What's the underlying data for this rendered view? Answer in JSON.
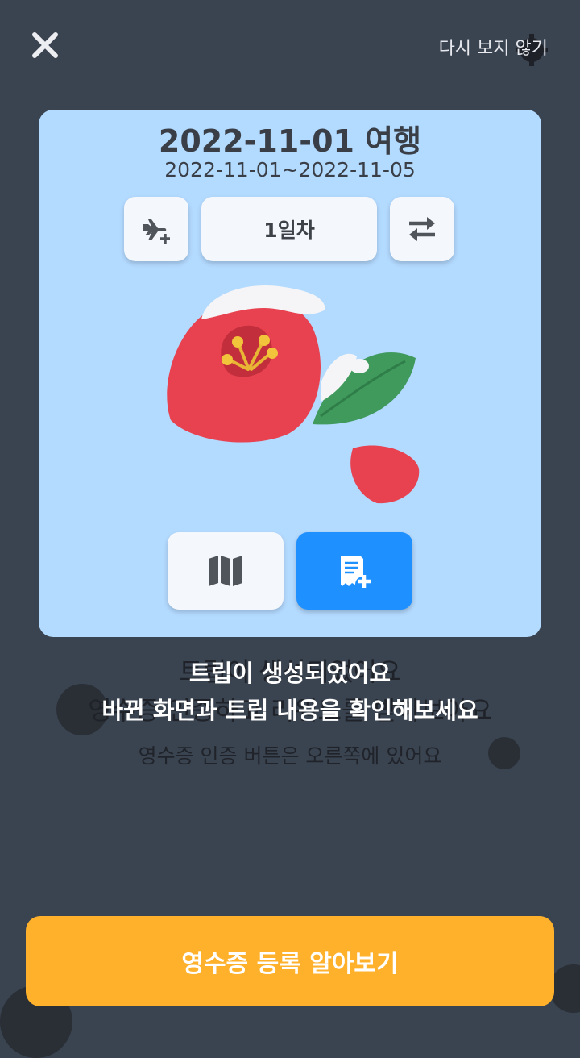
{
  "header": {
    "close_icon": "close-icon",
    "dont_show_again": "다시 보지 않기"
  },
  "trip_card": {
    "title": "2022-11-01 여행",
    "dates": "2022-11-01~2022-11-05",
    "add_flight_icon": "flight-add-icon",
    "day_label": "1일차",
    "swap_icon": "swap-icon",
    "illustration": "camellia-flower-icon",
    "map_icon": "map-icon",
    "receipt_add_icon": "receipt-add-icon"
  },
  "messages": {
    "line1": "트립이 생성되었어요",
    "line2": "바뀐 화면과 트립 내용을 확인해보세요",
    "behind_line1": "트립이 생성되었어요",
    "behind_line2": "영수증 인증하고 리워드를 받아보아요",
    "sub_line": "영수증 인증 버튼은 오른쪽에 있어요"
  },
  "cta": {
    "label": "영수증 등록 알아보기"
  },
  "colors": {
    "background": "#3a4350",
    "card": "#b3daff",
    "accent_blue": "#1e90ff",
    "cta_orange": "#ffb12b",
    "flower_red": "#e8414f",
    "leaf_green": "#3f9a5c"
  }
}
